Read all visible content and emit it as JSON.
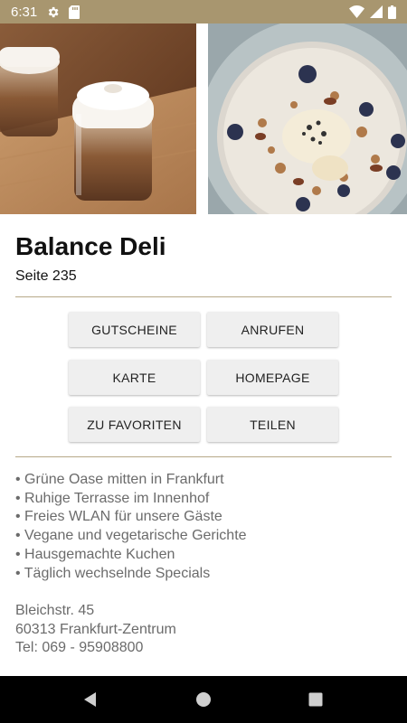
{
  "status_bar": {
    "time": "6:31",
    "background_color": "#a8966f",
    "icons": [
      "settings-icon",
      "sd-card-icon",
      "wifi-icon",
      "signal-icon",
      "battery-icon"
    ]
  },
  "photos": [
    {
      "icon": "cappuccino-photo"
    },
    {
      "icon": "muesli-bowl-photo"
    }
  ],
  "header": {
    "title": "Balance Deli",
    "subtitle": "Seite 235"
  },
  "actions": {
    "vouchers": "GUTSCHEINE",
    "call": "ANRUFEN",
    "map": "KARTE",
    "homepage": "HOMEPAGE",
    "favorites": "ZU FAVORITEN",
    "share": "TEILEN"
  },
  "features": [
    "Grüne Oase mitten in Frankfurt",
    "Ruhige Terrasse im Innenhof",
    "Freies WLAN für unsere Gäste",
    "Vegane und vegetarische Gerichte",
    "Hausgemachte Kuchen",
    "Täglich wechselnde Specials"
  ],
  "address": {
    "street": "Bleichstr. 45",
    "city": "60313 Frankfurt-Zentrum",
    "phone": "Tel: 069 - 95908800"
  },
  "colors": {
    "accent": "#a8966f",
    "divider": "#b7a888",
    "button_bg": "#efefef",
    "muted_text": "#6b6b6b"
  },
  "nav_bar": {
    "icons": [
      "back-icon",
      "home-icon",
      "recent-apps-icon"
    ]
  }
}
